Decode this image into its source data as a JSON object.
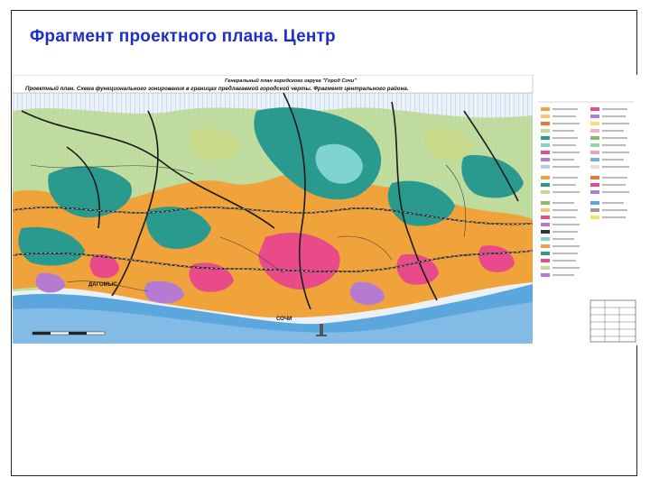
{
  "slide": {
    "title": "Фрагмент проектного плана. Центр"
  },
  "map": {
    "header_line1": "Генеральный план городского округа \"Город Сочи\"",
    "header_line2": "Проектный план. Схема функционального зонирования в границах предлагаемой городской черты. Фрагмент центрального района.",
    "city_labels": [
      "ДАГОМЫС",
      "СОЧИ"
    ],
    "colors": {
      "sea": "#5aa6dd",
      "sea_light": "#a9d2f0",
      "residential": "#f0a33b",
      "public_center": "#e84a8a",
      "green_recreation": "#2a9a8e",
      "forest": "#7fbf6a",
      "agricultural": "#c9d98a",
      "industrial": "#b57bd0",
      "roads": "#1a1a1a"
    }
  }
}
